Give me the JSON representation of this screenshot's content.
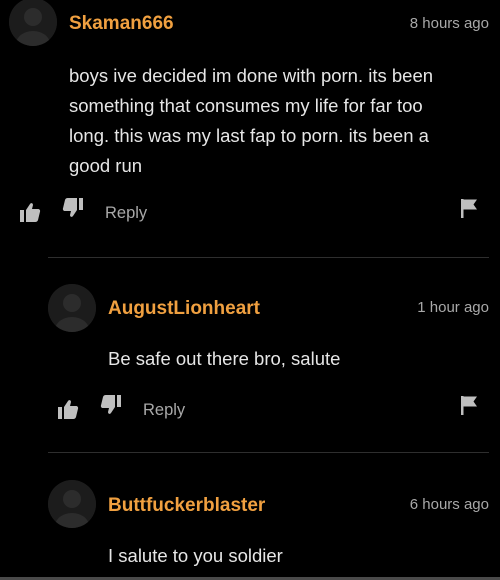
{
  "comments": [
    {
      "username": "Skaman666",
      "timestamp": "8 hours ago",
      "lines": [
        "boys ive decided im done with porn. its been",
        "something that consumes my life for far too",
        "long. this was my last fap to porn. its been a",
        "good run"
      ],
      "reply_label": "Reply"
    },
    {
      "username": "AugustLionheart",
      "timestamp": "1 hour ago",
      "lines": [
        "Be safe out there bro, salute"
      ],
      "reply_label": "Reply"
    },
    {
      "username": "Buttfuckerblaster",
      "timestamp": "6 hours ago",
      "lines": [
        "I salute to you soldier"
      ]
    }
  ],
  "colors": {
    "background": "#000000",
    "username": "#f0a040",
    "muted": "#a8a8a8",
    "text": "#e6e6e6",
    "divider": "#2e2e2e"
  },
  "icons": [
    "avatar-placeholder-icon",
    "thumbs-up-icon",
    "thumbs-down-icon",
    "flag-icon"
  ]
}
